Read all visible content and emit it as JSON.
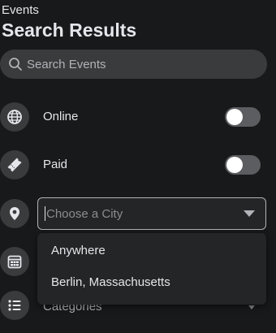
{
  "header": {
    "breadcrumb": "Events",
    "title": "Search Results"
  },
  "search": {
    "placeholder": "Search Events",
    "icon": "search-icon"
  },
  "filters": {
    "online": {
      "label": "Online",
      "icon": "globe-icon",
      "enabled": false
    },
    "paid": {
      "label": "Paid",
      "icon": "ticket-icon",
      "enabled": false
    },
    "city": {
      "placeholder": "Choose a City",
      "icon": "location-pin-icon"
    },
    "date": {
      "icon": "calendar-icon"
    },
    "categories": {
      "label": "Categories",
      "icon": "list-icon"
    }
  },
  "city_dropdown": {
    "options": [
      "Anywhere",
      "Berlin, Massachusetts"
    ]
  },
  "colors": {
    "background": "#18191a",
    "surface": "#3a3b3c",
    "text": "#e4e6eb",
    "secondary_text": "#b0b3b8",
    "toggle_off": "#5b5d60"
  }
}
